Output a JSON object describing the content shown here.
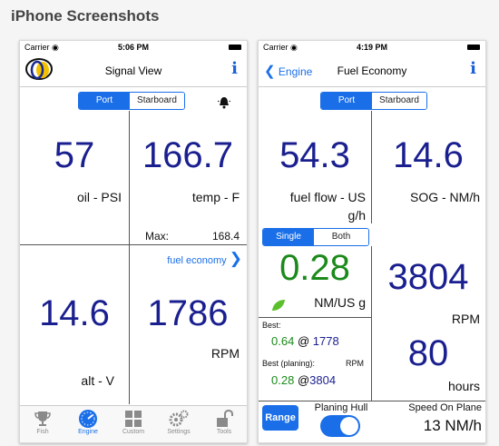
{
  "heading": "iPhone Screenshots",
  "status": {
    "carrier": "Carrier",
    "time1": "5:06 PM",
    "time2": "4:19 PM"
  },
  "p1": {
    "title": "Signal View",
    "seg": [
      "Port",
      "Starboard"
    ],
    "v1": "57",
    "l1": "oil - PSI",
    "v2": "166.7",
    "l2": "temp - F",
    "max_label": "Max:",
    "max_value": "168.4",
    "link": "fuel economy",
    "v3": "14.6",
    "l3": "alt - V",
    "v4": "1786",
    "l4": "RPM",
    "tabs": [
      "Fish",
      "Engine",
      "Custom",
      "Settings",
      "Tools"
    ]
  },
  "p2": {
    "back": "Engine",
    "title": "Fuel Economy",
    "seg": [
      "Port",
      "Starboard"
    ],
    "v1": "54.3",
    "l1a": "fuel flow - US",
    "l1b": "g/h",
    "v2": "14.6",
    "l2": "SOG - NM/h",
    "seg2": [
      "Single",
      "Both"
    ],
    "v3": "0.28",
    "l3": "NM/US g",
    "best_label": "Best:",
    "best_value": "0.64",
    "best_at": "@",
    "best_rpm": "1778",
    "bestp_label": "Best (planing):",
    "bestp_unit": "RPM",
    "bestp_value": "0.28",
    "bestp_at": "@",
    "bestp_rpm": "3804",
    "v4": "3804",
    "l4": "RPM",
    "v5": "80",
    "l5": "hours",
    "range": "Range",
    "planing": "Planing Hull",
    "sop_label": "Speed On Plane",
    "sop_value": "13 NM/h"
  }
}
